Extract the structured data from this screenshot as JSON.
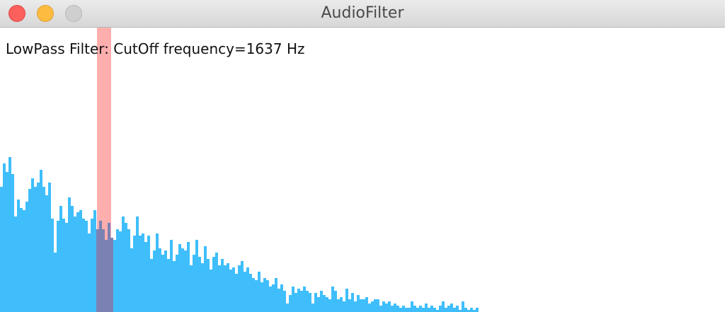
{
  "window": {
    "title": "AudioFilter"
  },
  "filter": {
    "label": "LowPass Filter: CutOff frequency=1637 Hz",
    "type": "LowPass",
    "cutoff_hz": 1637,
    "cutoff_fraction": 0.145
  },
  "colors": {
    "bars": "#3fbefb",
    "cutoff_band": "#ffaeae",
    "cutoff_overlap": "#7b82b3",
    "close": "#fc605c",
    "minimize": "#fdbc40",
    "zoom": "#cfcfcf"
  },
  "spectrum": {
    "bin_count": 165,
    "level_max": 1.0,
    "levels": [
      0.59,
      0.7,
      0.66,
      0.73,
      0.65,
      0.45,
      0.53,
      0.49,
      0.48,
      0.52,
      0.58,
      0.63,
      0.59,
      0.61,
      0.67,
      0.59,
      0.55,
      0.61,
      0.44,
      0.28,
      0.43,
      0.5,
      0.44,
      0.42,
      0.54,
      0.5,
      0.45,
      0.47,
      0.48,
      0.44,
      0.43,
      0.37,
      0.44,
      0.48,
      0.39,
      0.43,
      0.39,
      0.34,
      0.42,
      0.35,
      0.34,
      0.39,
      0.38,
      0.45,
      0.42,
      0.39,
      0.3,
      0.36,
      0.45,
      0.36,
      0.37,
      0.33,
      0.36,
      0.25,
      0.29,
      0.37,
      0.3,
      0.27,
      0.29,
      0.25,
      0.34,
      0.24,
      0.27,
      0.32,
      0.3,
      0.29,
      0.33,
      0.22,
      0.27,
      0.34,
      0.26,
      0.23,
      0.31,
      0.25,
      0.2,
      0.26,
      0.28,
      0.22,
      0.25,
      0.22,
      0.23,
      0.2,
      0.21,
      0.18,
      0.22,
      0.24,
      0.19,
      0.21,
      0.18,
      0.16,
      0.15,
      0.19,
      0.14,
      0.16,
      0.15,
      0.12,
      0.13,
      0.16,
      0.11,
      0.13,
      0.1,
      0.04,
      0.08,
      0.12,
      0.09,
      0.11,
      0.1,
      0.12,
      0.1,
      0.09,
      0.04,
      0.09,
      0.07,
      0.1,
      0.08,
      0.07,
      0.06,
      0.12,
      0.1,
      0.06,
      0.07,
      0.05,
      0.11,
      0.06,
      0.09,
      0.05,
      0.08,
      0.06,
      0.06,
      0.07,
      0.04,
      0.05,
      0.06,
      0.06,
      0.03,
      0.05,
      0.04,
      0.05,
      0.03,
      0.04,
      0.03,
      0.02,
      0.03,
      0.02,
      0.02,
      0.05,
      0.03,
      0.02,
      0.03,
      0.02,
      0.04,
      0.02,
      0.03,
      0.02,
      0.01,
      0.03,
      0.05,
      0.02,
      0.03,
      0.04,
      0.02,
      0.03,
      0.01,
      0.05,
      0.02,
      0.01,
      0.02,
      0.01,
      0.02
    ]
  }
}
